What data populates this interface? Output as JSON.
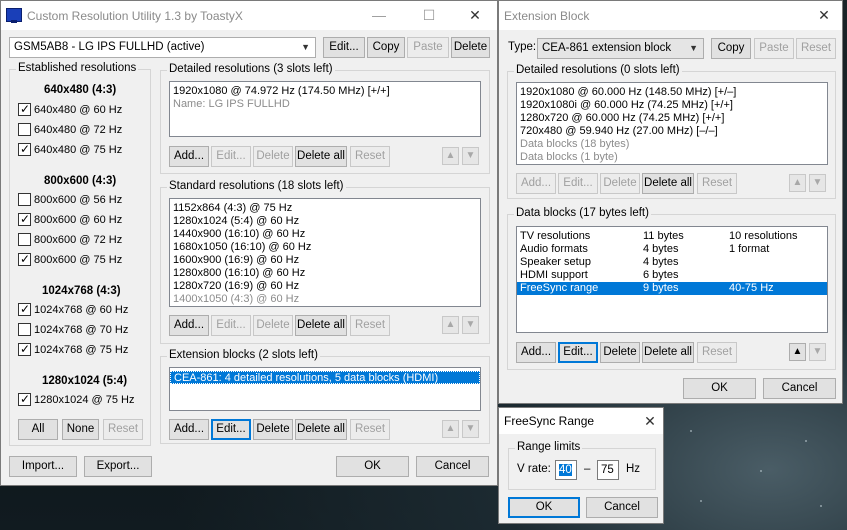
{
  "main": {
    "title": "Custom Resolution Utility 1.3 by ToastyX",
    "window_controls": {
      "minimize": "—",
      "maximize": "☐",
      "close": "✕"
    },
    "monitor_select": "GSM5AB8 - LG IPS FULLHD (active)",
    "top_buttons": {
      "edit": "Edit...",
      "copy": "Copy",
      "paste": "Paste",
      "delete": "Delete"
    },
    "established": {
      "legend": "Established resolutions",
      "groups": [
        {
          "header": "640x480 (4:3)",
          "items": [
            {
              "label": "640x480 @ 60 Hz",
              "checked": true
            },
            {
              "label": "640x480 @ 72 Hz",
              "checked": false
            },
            {
              "label": "640x480 @ 75 Hz",
              "checked": true
            }
          ]
        },
        {
          "header": "800x600 (4:3)",
          "items": [
            {
              "label": "800x600 @ 56 Hz",
              "checked": false
            },
            {
              "label": "800x600 @ 60 Hz",
              "checked": true
            },
            {
              "label": "800x600 @ 72 Hz",
              "checked": false
            },
            {
              "label": "800x600 @ 75 Hz",
              "checked": true
            }
          ]
        },
        {
          "header": "1024x768 (4:3)",
          "items": [
            {
              "label": "1024x768 @ 60 Hz",
              "checked": true
            },
            {
              "label": "1024x768 @ 70 Hz",
              "checked": false
            },
            {
              "label": "1024x768 @ 75 Hz",
              "checked": true
            }
          ]
        },
        {
          "header": "1280x1024 (5:4)",
          "items": [
            {
              "label": "1280x1024 @ 75 Hz",
              "checked": true
            }
          ]
        }
      ],
      "buttons": {
        "all": "All",
        "none": "None",
        "reset": "Reset"
      }
    },
    "detailed": {
      "legend": "Detailed resolutions (3 slots left)",
      "rows": [
        "1920x1080 @ 74.972 Hz (174.50 MHz) [+/+]",
        "Name: LG IPS FULLHD"
      ],
      "buttons": {
        "add": "Add...",
        "edit": "Edit...",
        "delete": "Delete",
        "delete_all": "Delete all",
        "reset": "Reset"
      }
    },
    "standard": {
      "legend": "Standard resolutions (18 slots left)",
      "rows": [
        "1152x864 (4:3) @ 75 Hz",
        "1280x1024 (5:4) @ 60 Hz",
        "1440x900 (16:10) @ 60 Hz",
        "1680x1050 (16:10) @ 60 Hz",
        "1600x900 (16:9) @ 60 Hz",
        "1280x800 (16:10) @ 60 Hz",
        "1280x720 (16:9) @ 60 Hz",
        "1400x1050 (4:3) @ 60 Hz"
      ],
      "buttons": {
        "add": "Add...",
        "edit": "Edit...",
        "delete": "Delete",
        "delete_all": "Delete all",
        "reset": "Reset"
      }
    },
    "extension": {
      "legend": "Extension blocks (2 slots left)",
      "rows": [
        "CEA-861: 4 detailed resolutions, 5 data blocks (HDMI)"
      ],
      "buttons": {
        "add": "Add...",
        "edit": "Edit...",
        "delete": "Delete",
        "delete_all": "Delete all",
        "reset": "Reset"
      }
    },
    "footer": {
      "import": "Import...",
      "export": "Export...",
      "ok": "OK",
      "cancel": "Cancel"
    }
  },
  "extblock": {
    "title": "Extension Block",
    "close": "✕",
    "type_label": "Type:",
    "type_value": "CEA-861 extension block",
    "buttons": {
      "copy": "Copy",
      "paste": "Paste",
      "reset": "Reset"
    },
    "detailed": {
      "legend": "Detailed resolutions (0 slots left)",
      "rows": [
        "1920x1080 @ 60.000 Hz (148.50 MHz) [+/–]",
        "1920x1080i @ 60.000 Hz (74.25 MHz) [+/+]",
        "1280x720 @ 60.000 Hz (74.25 MHz) [+/+]",
        "720x480 @ 59.940 Hz (27.00 MHz) [–/–]",
        "Data blocks (18 bytes)",
        "Data blocks (1 byte)"
      ],
      "buttons": {
        "add": "Add...",
        "edit": "Edit...",
        "delete": "Delete",
        "delete_all": "Delete all",
        "reset": "Reset"
      }
    },
    "datablocks": {
      "legend": "Data blocks (17 bytes left)",
      "rows": [
        [
          "TV resolutions",
          "11 bytes",
          "10 resolutions"
        ],
        [
          "Audio formats",
          "4 bytes",
          "1 format"
        ],
        [
          "Speaker setup",
          "4 bytes",
          ""
        ],
        [
          "HDMI support",
          "6 bytes",
          ""
        ],
        [
          "FreeSync range",
          "9 bytes",
          "40-75 Hz"
        ]
      ],
      "buttons": {
        "add": "Add...",
        "edit": "Edit...",
        "delete": "Delete",
        "delete_all": "Delete all",
        "reset": "Reset"
      }
    },
    "footer": {
      "ok": "OK",
      "cancel": "Cancel"
    }
  },
  "freesync": {
    "title": "FreeSync Range",
    "close": "✕",
    "legend": "Range limits",
    "vrate_label": "V rate:",
    "min": "40",
    "dash": "–",
    "max": "75",
    "unit": "Hz",
    "ok": "OK",
    "cancel": "Cancel"
  }
}
